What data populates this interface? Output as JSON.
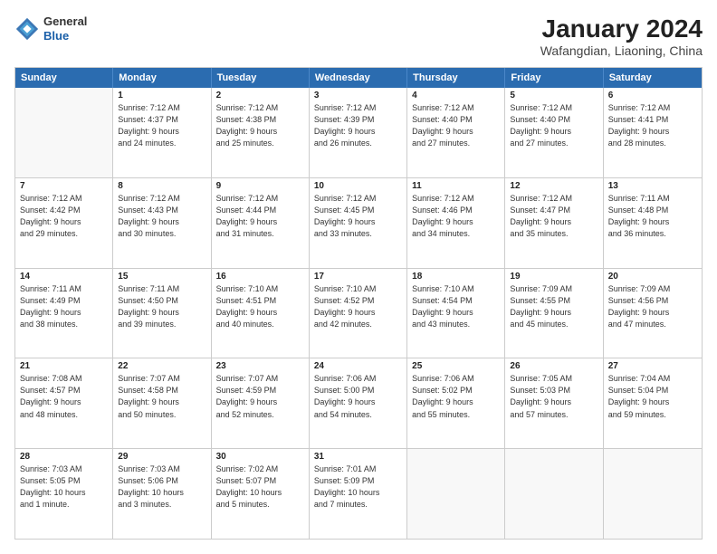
{
  "header": {
    "logo": {
      "general": "General",
      "blue": "Blue"
    },
    "title": "January 2024",
    "location": "Wafangdian, Liaoning, China"
  },
  "weekdays": [
    "Sunday",
    "Monday",
    "Tuesday",
    "Wednesday",
    "Thursday",
    "Friday",
    "Saturday"
  ],
  "rows": [
    [
      {
        "day": "",
        "lines": []
      },
      {
        "day": "1",
        "lines": [
          "Sunrise: 7:12 AM",
          "Sunset: 4:37 PM",
          "Daylight: 9 hours",
          "and 24 minutes."
        ]
      },
      {
        "day": "2",
        "lines": [
          "Sunrise: 7:12 AM",
          "Sunset: 4:38 PM",
          "Daylight: 9 hours",
          "and 25 minutes."
        ]
      },
      {
        "day": "3",
        "lines": [
          "Sunrise: 7:12 AM",
          "Sunset: 4:39 PM",
          "Daylight: 9 hours",
          "and 26 minutes."
        ]
      },
      {
        "day": "4",
        "lines": [
          "Sunrise: 7:12 AM",
          "Sunset: 4:40 PM",
          "Daylight: 9 hours",
          "and 27 minutes."
        ]
      },
      {
        "day": "5",
        "lines": [
          "Sunrise: 7:12 AM",
          "Sunset: 4:40 PM",
          "Daylight: 9 hours",
          "and 27 minutes."
        ]
      },
      {
        "day": "6",
        "lines": [
          "Sunrise: 7:12 AM",
          "Sunset: 4:41 PM",
          "Daylight: 9 hours",
          "and 28 minutes."
        ]
      }
    ],
    [
      {
        "day": "7",
        "lines": [
          "Sunrise: 7:12 AM",
          "Sunset: 4:42 PM",
          "Daylight: 9 hours",
          "and 29 minutes."
        ]
      },
      {
        "day": "8",
        "lines": [
          "Sunrise: 7:12 AM",
          "Sunset: 4:43 PM",
          "Daylight: 9 hours",
          "and 30 minutes."
        ]
      },
      {
        "day": "9",
        "lines": [
          "Sunrise: 7:12 AM",
          "Sunset: 4:44 PM",
          "Daylight: 9 hours",
          "and 31 minutes."
        ]
      },
      {
        "day": "10",
        "lines": [
          "Sunrise: 7:12 AM",
          "Sunset: 4:45 PM",
          "Daylight: 9 hours",
          "and 33 minutes."
        ]
      },
      {
        "day": "11",
        "lines": [
          "Sunrise: 7:12 AM",
          "Sunset: 4:46 PM",
          "Daylight: 9 hours",
          "and 34 minutes."
        ]
      },
      {
        "day": "12",
        "lines": [
          "Sunrise: 7:12 AM",
          "Sunset: 4:47 PM",
          "Daylight: 9 hours",
          "and 35 minutes."
        ]
      },
      {
        "day": "13",
        "lines": [
          "Sunrise: 7:11 AM",
          "Sunset: 4:48 PM",
          "Daylight: 9 hours",
          "and 36 minutes."
        ]
      }
    ],
    [
      {
        "day": "14",
        "lines": [
          "Sunrise: 7:11 AM",
          "Sunset: 4:49 PM",
          "Daylight: 9 hours",
          "and 38 minutes."
        ]
      },
      {
        "day": "15",
        "lines": [
          "Sunrise: 7:11 AM",
          "Sunset: 4:50 PM",
          "Daylight: 9 hours",
          "and 39 minutes."
        ]
      },
      {
        "day": "16",
        "lines": [
          "Sunrise: 7:10 AM",
          "Sunset: 4:51 PM",
          "Daylight: 9 hours",
          "and 40 minutes."
        ]
      },
      {
        "day": "17",
        "lines": [
          "Sunrise: 7:10 AM",
          "Sunset: 4:52 PM",
          "Daylight: 9 hours",
          "and 42 minutes."
        ]
      },
      {
        "day": "18",
        "lines": [
          "Sunrise: 7:10 AM",
          "Sunset: 4:54 PM",
          "Daylight: 9 hours",
          "and 43 minutes."
        ]
      },
      {
        "day": "19",
        "lines": [
          "Sunrise: 7:09 AM",
          "Sunset: 4:55 PM",
          "Daylight: 9 hours",
          "and 45 minutes."
        ]
      },
      {
        "day": "20",
        "lines": [
          "Sunrise: 7:09 AM",
          "Sunset: 4:56 PM",
          "Daylight: 9 hours",
          "and 47 minutes."
        ]
      }
    ],
    [
      {
        "day": "21",
        "lines": [
          "Sunrise: 7:08 AM",
          "Sunset: 4:57 PM",
          "Daylight: 9 hours",
          "and 48 minutes."
        ]
      },
      {
        "day": "22",
        "lines": [
          "Sunrise: 7:07 AM",
          "Sunset: 4:58 PM",
          "Daylight: 9 hours",
          "and 50 minutes."
        ]
      },
      {
        "day": "23",
        "lines": [
          "Sunrise: 7:07 AM",
          "Sunset: 4:59 PM",
          "Daylight: 9 hours",
          "and 52 minutes."
        ]
      },
      {
        "day": "24",
        "lines": [
          "Sunrise: 7:06 AM",
          "Sunset: 5:00 PM",
          "Daylight: 9 hours",
          "and 54 minutes."
        ]
      },
      {
        "day": "25",
        "lines": [
          "Sunrise: 7:06 AM",
          "Sunset: 5:02 PM",
          "Daylight: 9 hours",
          "and 55 minutes."
        ]
      },
      {
        "day": "26",
        "lines": [
          "Sunrise: 7:05 AM",
          "Sunset: 5:03 PM",
          "Daylight: 9 hours",
          "and 57 minutes."
        ]
      },
      {
        "day": "27",
        "lines": [
          "Sunrise: 7:04 AM",
          "Sunset: 5:04 PM",
          "Daylight: 9 hours",
          "and 59 minutes."
        ]
      }
    ],
    [
      {
        "day": "28",
        "lines": [
          "Sunrise: 7:03 AM",
          "Sunset: 5:05 PM",
          "Daylight: 10 hours",
          "and 1 minute."
        ]
      },
      {
        "day": "29",
        "lines": [
          "Sunrise: 7:03 AM",
          "Sunset: 5:06 PM",
          "Daylight: 10 hours",
          "and 3 minutes."
        ]
      },
      {
        "day": "30",
        "lines": [
          "Sunrise: 7:02 AM",
          "Sunset: 5:07 PM",
          "Daylight: 10 hours",
          "and 5 minutes."
        ]
      },
      {
        "day": "31",
        "lines": [
          "Sunrise: 7:01 AM",
          "Sunset: 5:09 PM",
          "Daylight: 10 hours",
          "and 7 minutes."
        ]
      },
      {
        "day": "",
        "lines": []
      },
      {
        "day": "",
        "lines": []
      },
      {
        "day": "",
        "lines": []
      }
    ]
  ]
}
